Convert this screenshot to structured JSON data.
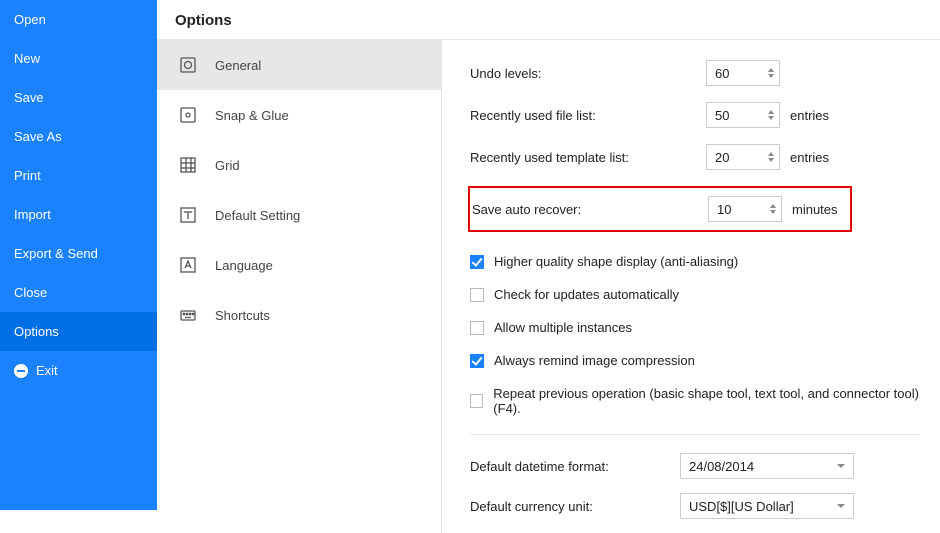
{
  "sidebar": {
    "items": [
      {
        "label": "Open"
      },
      {
        "label": "New"
      },
      {
        "label": "Save"
      },
      {
        "label": "Save As"
      },
      {
        "label": "Print"
      },
      {
        "label": "Import"
      },
      {
        "label": "Export & Send"
      },
      {
        "label": "Close"
      },
      {
        "label": "Options"
      },
      {
        "label": "Exit"
      }
    ],
    "selected": "Options"
  },
  "page_title": "Options",
  "tabs": [
    {
      "label": "General"
    },
    {
      "label": "Snap & Glue"
    },
    {
      "label": "Grid"
    },
    {
      "label": "Default Setting"
    },
    {
      "label": "Language"
    },
    {
      "label": "Shortcuts"
    }
  ],
  "active_tab": "General",
  "numeric": {
    "undo_levels": {
      "label": "Undo levels:",
      "value": "60",
      "suffix": ""
    },
    "recent_files": {
      "label": "Recently used file list:",
      "value": "50",
      "suffix": "entries"
    },
    "recent_templates": {
      "label": "Recently used template list:",
      "value": "20",
      "suffix": "entries"
    },
    "auto_recover": {
      "label": "Save auto recover:",
      "value": "10",
      "suffix": "minutes"
    }
  },
  "checkboxes": {
    "anti_aliasing": {
      "label": "Higher quality shape display (anti-aliasing)",
      "checked": true
    },
    "check_updates": {
      "label": "Check for updates automatically",
      "checked": false
    },
    "multiple_instances": {
      "label": "Allow multiple instances",
      "checked": false
    },
    "image_compression": {
      "label": "Always remind image compression",
      "checked": true
    },
    "repeat_operation": {
      "label": "Repeat previous operation (basic shape tool, text tool, and connector tool)(F4).",
      "checked": false
    }
  },
  "selects": {
    "datetime": {
      "label": "Default datetime format:",
      "value": "24/08/2014"
    },
    "currency": {
      "label": "Default currency unit:",
      "value": "USD[$][US Dollar]"
    }
  }
}
